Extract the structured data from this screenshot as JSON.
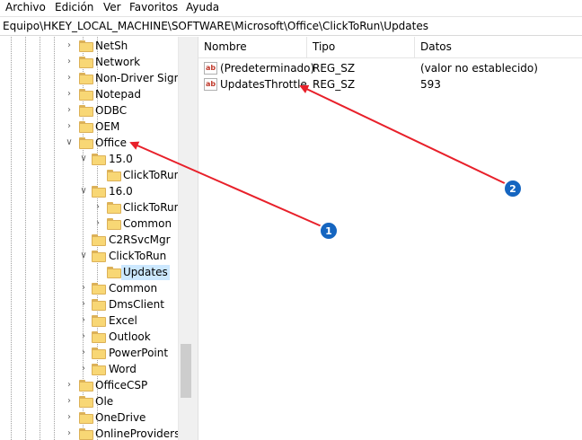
{
  "menu": {
    "items": [
      "Archivo",
      "Edición",
      "Ver",
      "Favoritos",
      "Ayuda"
    ]
  },
  "address": {
    "path": "Equipo\\HKEY_LOCAL_MACHINE\\SOFTWARE\\Microsoft\\Office\\ClickToRun\\Updates"
  },
  "tree": {
    "items": [
      {
        "label": "NetSh",
        "expander": "collapsed",
        "selected": false
      },
      {
        "label": "Network",
        "expander": "collapsed",
        "selected": false
      },
      {
        "label": "Non-Driver Signin",
        "expander": "collapsed",
        "selected": false
      },
      {
        "label": "Notepad",
        "expander": "collapsed",
        "selected": false
      },
      {
        "label": "ODBC",
        "expander": "collapsed",
        "selected": false
      },
      {
        "label": "OEM",
        "expander": "collapsed",
        "selected": false
      },
      {
        "label": "Office",
        "expander": "expanded",
        "selected": false
      },
      {
        "label": "15.0",
        "expander": "expanded",
        "selected": false
      },
      {
        "label": "ClickToRun",
        "expander": "none",
        "selected": false
      },
      {
        "label": "16.0",
        "expander": "expanded",
        "selected": false
      },
      {
        "label": "ClickToRun",
        "expander": "collapsed",
        "selected": false
      },
      {
        "label": "Common",
        "expander": "collapsed",
        "selected": false
      },
      {
        "label": "C2RSvcMgr",
        "expander": "none",
        "selected": false
      },
      {
        "label": "ClickToRun",
        "expander": "expanded",
        "selected": false
      },
      {
        "label": "Updates",
        "expander": "none",
        "selected": true
      },
      {
        "label": "Common",
        "expander": "collapsed",
        "selected": false
      },
      {
        "label": "DmsClient",
        "expander": "collapsed",
        "selected": false
      },
      {
        "label": "Excel",
        "expander": "collapsed",
        "selected": false
      },
      {
        "label": "Outlook",
        "expander": "collapsed",
        "selected": false
      },
      {
        "label": "PowerPoint",
        "expander": "collapsed",
        "selected": false
      },
      {
        "label": "Word",
        "expander": "collapsed",
        "selected": false
      },
      {
        "label": "OfficeCSP",
        "expander": "collapsed",
        "selected": false
      },
      {
        "label": "Ole",
        "expander": "collapsed",
        "selected": false
      },
      {
        "label": "OneDrive",
        "expander": "collapsed",
        "selected": false
      },
      {
        "label": "OnlineProviders",
        "expander": "collapsed",
        "selected": false
      }
    ]
  },
  "list": {
    "columns": [
      "Nombre",
      "Tipo",
      "Datos"
    ],
    "rows": [
      {
        "icon": "string-value-icon",
        "icon_text": "ab",
        "name": "(Predeterminado)",
        "type": "REG_SZ",
        "data": "(valor no establecido)"
      },
      {
        "icon": "string-value-icon",
        "icon_text": "ab",
        "name": "UpdatesThrottle",
        "type": "REG_SZ",
        "data": "593"
      }
    ]
  },
  "annotations": {
    "callouts": [
      {
        "number": "1",
        "color": "#1565c0"
      },
      {
        "number": "2",
        "color": "#1565c0"
      }
    ],
    "arrow_color": "#e8202a"
  },
  "colors": {
    "selection": "#cce8ff",
    "folder": "#f8d775"
  }
}
